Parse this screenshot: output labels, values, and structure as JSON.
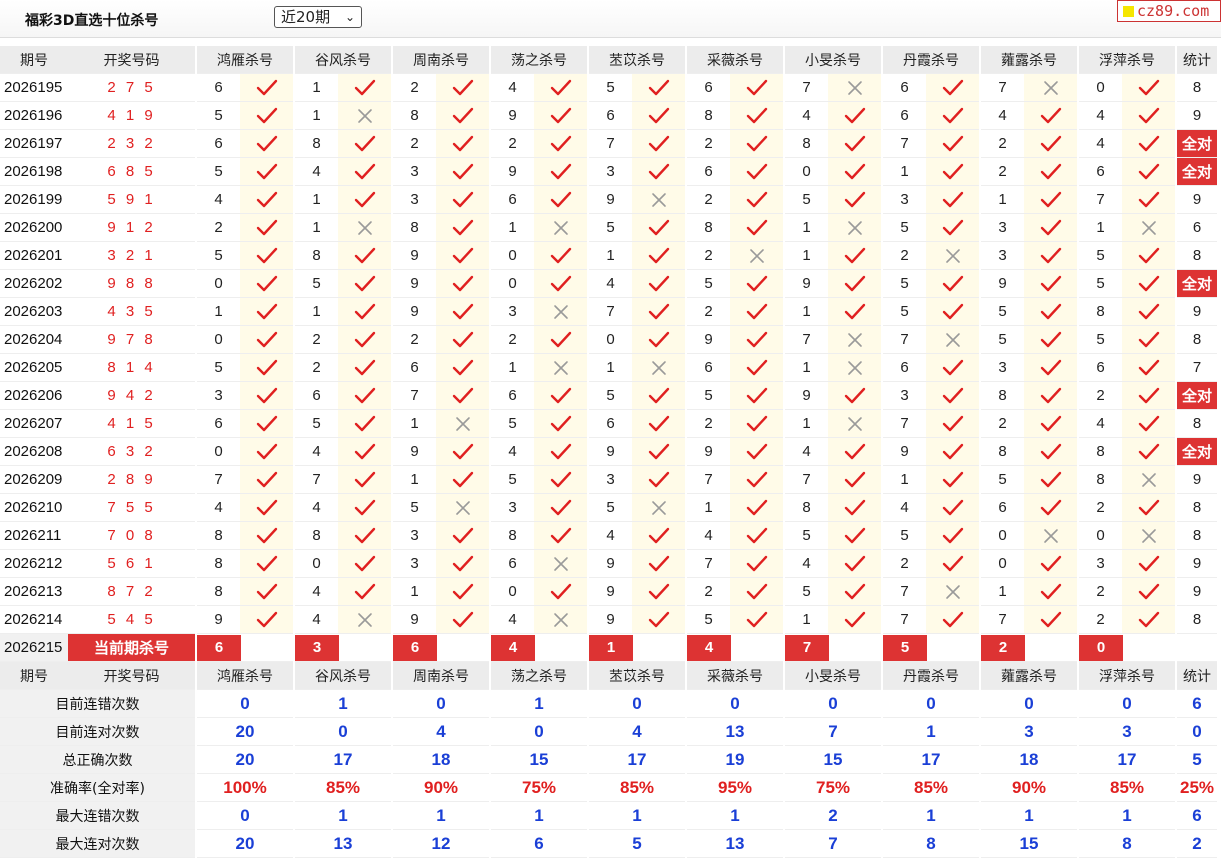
{
  "header": {
    "title": "福彩3D直选十位杀号",
    "period_select": "近20期",
    "site_badge": "cz89.com"
  },
  "columns": {
    "period": "期号",
    "number": "开奖号码",
    "methods": [
      "鸿雁杀号",
      "谷风杀号",
      "周南杀号",
      "荡之杀号",
      "苤苡杀号",
      "采薇杀号",
      "小旻杀号",
      "丹霞杀号",
      "蕹露杀号",
      "浮萍杀号"
    ],
    "count": "统计"
  },
  "rows": [
    {
      "period": "2026195",
      "number": "2 7 5",
      "kills": [
        6,
        1,
        2,
        4,
        5,
        6,
        7,
        6,
        7,
        0
      ],
      "ok": [
        1,
        1,
        1,
        1,
        1,
        1,
        0,
        1,
        0,
        1
      ],
      "count": "8"
    },
    {
      "period": "2026196",
      "number": "4 1 9",
      "kills": [
        5,
        1,
        8,
        9,
        6,
        8,
        4,
        6,
        4,
        4
      ],
      "ok": [
        1,
        0,
        1,
        1,
        1,
        1,
        1,
        1,
        1,
        1
      ],
      "count": "9"
    },
    {
      "period": "2026197",
      "number": "2 3 2",
      "kills": [
        6,
        8,
        2,
        2,
        7,
        2,
        8,
        7,
        2,
        4
      ],
      "ok": [
        1,
        1,
        1,
        1,
        1,
        1,
        1,
        1,
        1,
        1
      ],
      "count": "全对"
    },
    {
      "period": "2026198",
      "number": "6 8 5",
      "kills": [
        5,
        4,
        3,
        9,
        3,
        6,
        0,
        1,
        2,
        6
      ],
      "ok": [
        1,
        1,
        1,
        1,
        1,
        1,
        1,
        1,
        1,
        1
      ],
      "count": "全对"
    },
    {
      "period": "2026199",
      "number": "5 9 1",
      "kills": [
        4,
        1,
        3,
        6,
        9,
        2,
        5,
        3,
        1,
        7
      ],
      "ok": [
        1,
        1,
        1,
        1,
        0,
        1,
        1,
        1,
        1,
        1
      ],
      "count": "9"
    },
    {
      "period": "2026200",
      "number": "9 1 2",
      "kills": [
        2,
        1,
        8,
        1,
        5,
        8,
        1,
        5,
        3,
        1
      ],
      "ok": [
        1,
        0,
        1,
        0,
        1,
        1,
        0,
        1,
        1,
        0
      ],
      "count": "6"
    },
    {
      "period": "2026201",
      "number": "3 2 1",
      "kills": [
        5,
        8,
        9,
        0,
        1,
        2,
        1,
        2,
        3,
        5
      ],
      "ok": [
        1,
        1,
        1,
        1,
        1,
        0,
        1,
        0,
        1,
        1
      ],
      "count": "8"
    },
    {
      "period": "2026202",
      "number": "9 8 8",
      "kills": [
        0,
        5,
        9,
        0,
        4,
        5,
        9,
        5,
        9,
        5
      ],
      "ok": [
        1,
        1,
        1,
        1,
        1,
        1,
        1,
        1,
        1,
        1
      ],
      "count": "全对"
    },
    {
      "period": "2026203",
      "number": "4 3 5",
      "kills": [
        1,
        1,
        9,
        3,
        7,
        2,
        1,
        5,
        5,
        8
      ],
      "ok": [
        1,
        1,
        1,
        0,
        1,
        1,
        1,
        1,
        1,
        1
      ],
      "count": "9"
    },
    {
      "period": "2026204",
      "number": "9 7 8",
      "kills": [
        0,
        2,
        2,
        2,
        0,
        9,
        7,
        7,
        5,
        5
      ],
      "ok": [
        1,
        1,
        1,
        1,
        1,
        1,
        0,
        0,
        1,
        1
      ],
      "count": "8"
    },
    {
      "period": "2026205",
      "number": "8 1 4",
      "kills": [
        5,
        2,
        6,
        1,
        1,
        6,
        1,
        6,
        3,
        6
      ],
      "ok": [
        1,
        1,
        1,
        0,
        0,
        1,
        0,
        1,
        1,
        1
      ],
      "count": "7"
    },
    {
      "period": "2026206",
      "number": "9 4 2",
      "kills": [
        3,
        6,
        7,
        6,
        5,
        5,
        9,
        3,
        8,
        2
      ],
      "ok": [
        1,
        1,
        1,
        1,
        1,
        1,
        1,
        1,
        1,
        1
      ],
      "count": "全对"
    },
    {
      "period": "2026207",
      "number": "4 1 5",
      "kills": [
        6,
        5,
        1,
        5,
        6,
        2,
        1,
        7,
        2,
        4
      ],
      "ok": [
        1,
        1,
        0,
        1,
        1,
        1,
        0,
        1,
        1,
        1
      ],
      "count": "8"
    },
    {
      "period": "2026208",
      "number": "6 3 2",
      "kills": [
        0,
        4,
        9,
        4,
        9,
        9,
        4,
        9,
        8,
        8
      ],
      "ok": [
        1,
        1,
        1,
        1,
        1,
        1,
        1,
        1,
        1,
        1
      ],
      "count": "全对"
    },
    {
      "period": "2026209",
      "number": "2 8 9",
      "kills": [
        7,
        7,
        1,
        5,
        3,
        7,
        7,
        1,
        5,
        8
      ],
      "ok": [
        1,
        1,
        1,
        1,
        1,
        1,
        1,
        1,
        1,
        0
      ],
      "count": "9"
    },
    {
      "period": "2026210",
      "number": "7 5 5",
      "kills": [
        4,
        4,
        5,
        3,
        5,
        1,
        8,
        4,
        6,
        2
      ],
      "ok": [
        1,
        1,
        0,
        1,
        0,
        1,
        1,
        1,
        1,
        1
      ],
      "count": "8"
    },
    {
      "period": "2026211",
      "number": "7 0 8",
      "kills": [
        8,
        8,
        3,
        8,
        4,
        4,
        5,
        5,
        0,
        0
      ],
      "ok": [
        1,
        1,
        1,
        1,
        1,
        1,
        1,
        1,
        0,
        0
      ],
      "count": "8"
    },
    {
      "period": "2026212",
      "number": "5 6 1",
      "kills": [
        8,
        0,
        3,
        6,
        9,
        7,
        4,
        2,
        0,
        3
      ],
      "ok": [
        1,
        1,
        1,
        0,
        1,
        1,
        1,
        1,
        1,
        1
      ],
      "count": "9"
    },
    {
      "period": "2026213",
      "number": "8 7 2",
      "kills": [
        8,
        4,
        1,
        0,
        9,
        2,
        5,
        7,
        1,
        2
      ],
      "ok": [
        1,
        1,
        1,
        1,
        1,
        1,
        1,
        0,
        1,
        1
      ],
      "count": "9"
    },
    {
      "period": "2026214",
      "number": "5 4 5",
      "kills": [
        9,
        4,
        9,
        4,
        9,
        5,
        1,
        7,
        7,
        2
      ],
      "ok": [
        1,
        0,
        1,
        0,
        1,
        1,
        1,
        1,
        1,
        1
      ],
      "count": "8"
    }
  ],
  "current": {
    "period": "2026215",
    "label": "当前期杀号",
    "kills": [
      "6",
      "3",
      "6",
      "4",
      "1",
      "4",
      "7",
      "5",
      "2",
      "0"
    ]
  },
  "stats": [
    {
      "label": "目前连错次数",
      "values": [
        "0",
        "1",
        "0",
        "1",
        "0",
        "0",
        "0",
        "0",
        "0",
        "0"
      ],
      "count": "6",
      "color": "blue"
    },
    {
      "label": "目前连对次数",
      "values": [
        "20",
        "0",
        "4",
        "0",
        "4",
        "13",
        "7",
        "1",
        "3",
        "3"
      ],
      "count": "0",
      "color": "blue"
    },
    {
      "label": "总正确次数",
      "values": [
        "20",
        "17",
        "18",
        "15",
        "17",
        "19",
        "15",
        "17",
        "18",
        "17"
      ],
      "count": "5",
      "color": "blue"
    },
    {
      "label": "准确率(全对率)",
      "values": [
        "100%",
        "85%",
        "90%",
        "75%",
        "85%",
        "95%",
        "75%",
        "85%",
        "90%",
        "85%"
      ],
      "count": "25%",
      "color": "red"
    },
    {
      "label": "最大连错次数",
      "values": [
        "0",
        "1",
        "1",
        "1",
        "1",
        "1",
        "2",
        "1",
        "1",
        "1"
      ],
      "count": "6",
      "color": "blue"
    },
    {
      "label": "最大连对次数",
      "values": [
        "20",
        "13",
        "12",
        "6",
        "5",
        "13",
        "7",
        "8",
        "15",
        "8"
      ],
      "count": "2",
      "color": "blue"
    }
  ],
  "colors": {
    "accent": "#dd3333",
    "check": "#e02020",
    "cross": "#999999",
    "stat_blue": "#1a3fd6"
  }
}
